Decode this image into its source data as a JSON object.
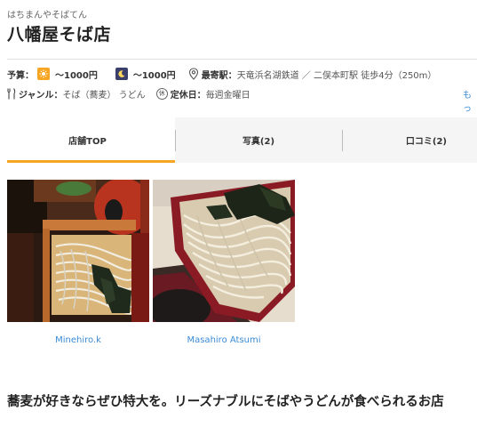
{
  "shop": {
    "furigana": "はちまんやそばてん",
    "name": "八幡屋そば店"
  },
  "info": {
    "budget_label": "予算：",
    "lunch_budget": "～1000円",
    "dinner_budget": "～1000円",
    "station_label": "最寄駅：",
    "station_value": "天竜浜名湖鉄道 ／ 二俣本町駅 徒歩4分（250m）",
    "genre_label": "ジャンル：",
    "genre_value": "そば（蕎麦） うどん",
    "holiday_icon_text": "休",
    "holiday_label": "定休日：",
    "holiday_value": "毎週金曜日",
    "more_link": "もっ"
  },
  "tabs": [
    {
      "label": "店舗TOP",
      "active": true
    },
    {
      "label": "写真(2)",
      "active": false
    },
    {
      "label": "口コミ(2)",
      "active": false
    }
  ],
  "photos": [
    {
      "credit": "Minehiro.k"
    },
    {
      "credit": "Masahiro Atsumi"
    }
  ],
  "catchphrase": "蕎麦が好きならぜひ特大を。リーズナブルにそばやうどんが食べられるお店",
  "colors": {
    "accent": "#f6a623",
    "link": "#3a8bd6",
    "night_icon": "#3b3f6b"
  },
  "icons": {
    "lunch": "sun-icon",
    "dinner": "moon-icon",
    "station": "map-pin-icon",
    "genre": "fork-knife-icon",
    "holiday": "holiday-icon"
  }
}
